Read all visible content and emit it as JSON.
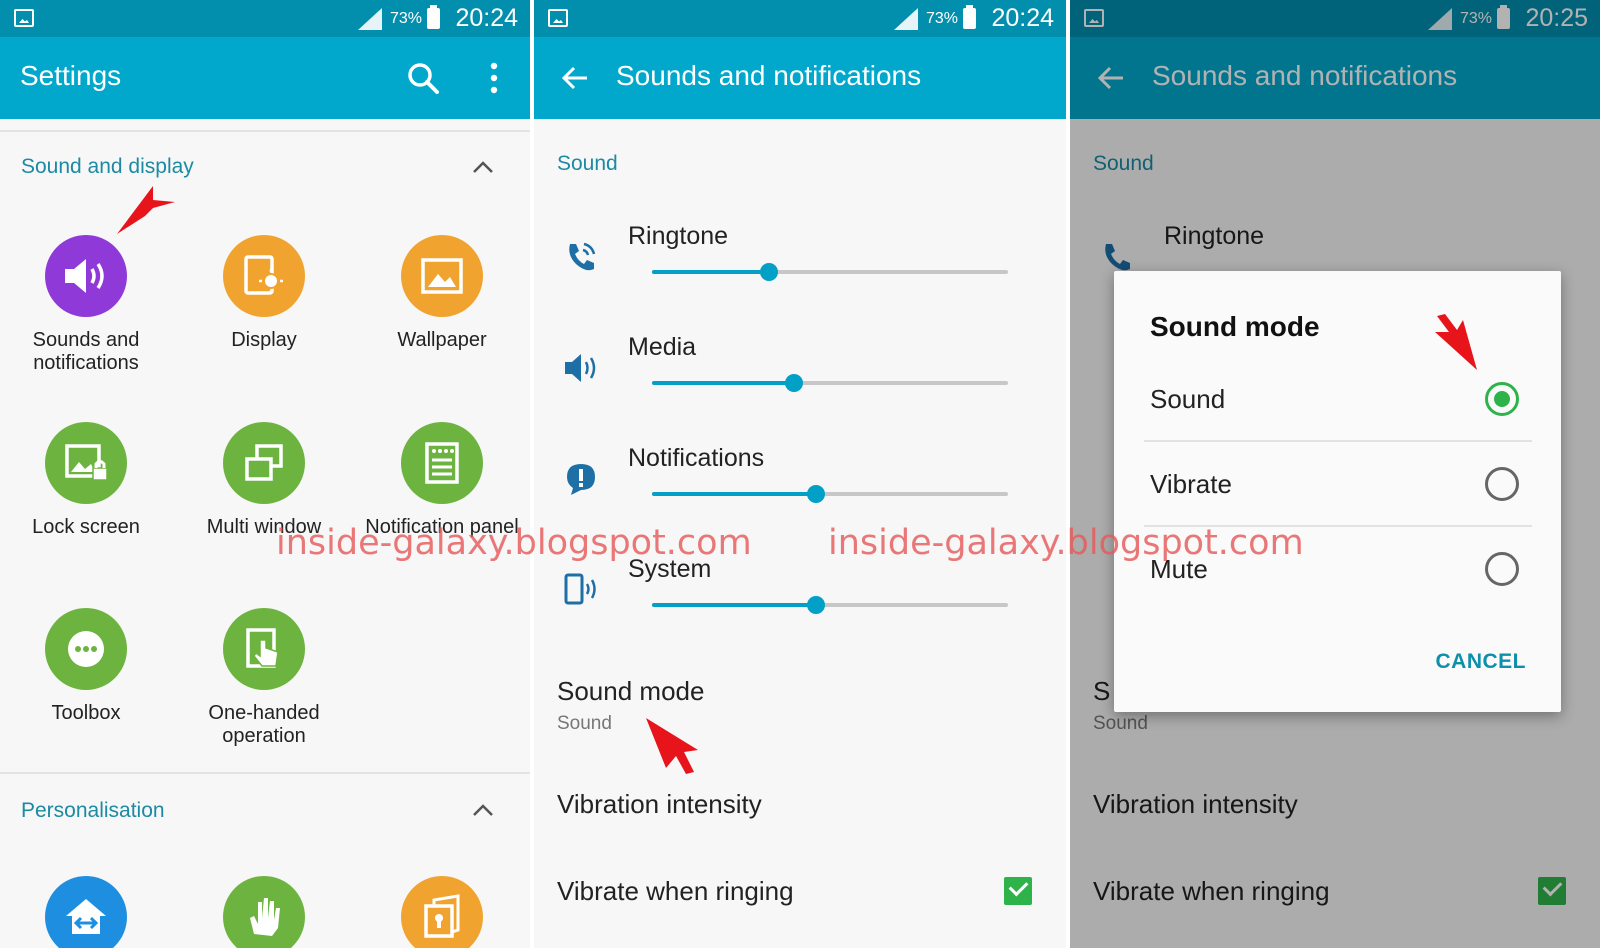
{
  "panel1": {
    "status": {
      "battery": "73%",
      "time": "20:24"
    },
    "appbar": {
      "title": "Settings",
      "search_icon": "search-icon",
      "more_icon": "more-vert-icon"
    },
    "section_sound_display": "Sound and display",
    "tiles": [
      {
        "label": "Sounds and notifications",
        "icon": "volume-icon",
        "color": "#8f3ad8"
      },
      {
        "label": "Display",
        "icon": "display-icon",
        "color": "#f0a42f"
      },
      {
        "label": "Wallpaper",
        "icon": "wallpaper-icon",
        "color": "#f0a42f"
      },
      {
        "label": "Lock screen",
        "icon": "lock-screen-icon",
        "color": "#6db33f"
      },
      {
        "label": "Multi window",
        "icon": "multi-window-icon",
        "color": "#6db33f"
      },
      {
        "label": "Notification panel",
        "icon": "notification-panel-icon",
        "color": "#6db33f"
      },
      {
        "label": "Toolbox",
        "icon": "toolbox-icon",
        "color": "#6db33f"
      },
      {
        "label": "One-handed operation",
        "icon": "one-handed-icon",
        "color": "#6db33f"
      }
    ],
    "section_personalisation": "Personalisation",
    "personal_tiles": [
      {
        "icon": "easy-mode-icon",
        "color": "#1e8fe0"
      },
      {
        "icon": "motions-icon",
        "color": "#6db33f"
      },
      {
        "icon": "private-mode-icon",
        "color": "#f0a42f"
      }
    ]
  },
  "panel2": {
    "status": {
      "battery": "73%",
      "time": "20:24"
    },
    "appbar": {
      "title": "Sounds and notifications"
    },
    "sound_header": "Sound",
    "volumes": [
      {
        "label": "Ringtone",
        "icon": "ringtone-icon",
        "level": 0.33
      },
      {
        "label": "Media",
        "icon": "media-volume-icon",
        "level": 0.4
      },
      {
        "label": "Notifications",
        "icon": "notification-icon",
        "level": 0.46
      },
      {
        "label": "System",
        "icon": "system-icon",
        "level": 0.46
      }
    ],
    "sound_mode": {
      "title": "Sound mode",
      "value": "Sound"
    },
    "vibration_intensity": "Vibration intensity",
    "vibrate_when_ringing": {
      "label": "Vibrate when ringing",
      "checked": true
    }
  },
  "panel3": {
    "status": {
      "battery": "73%",
      "time": "20:25"
    },
    "appbar": {
      "title": "Sounds and notifications"
    },
    "sound_header": "Sound",
    "ringtone_label": "Ringtone",
    "sound_mode_partial": "S",
    "sound_mode_value": "Sound",
    "vibration_intensity": "Vibration intensity",
    "vibrate_when_ringing": "Vibrate when ringing",
    "dialog": {
      "title": "Sound mode",
      "options": [
        {
          "label": "Sound",
          "selected": true
        },
        {
          "label": "Vibrate",
          "selected": false
        },
        {
          "label": "Mute",
          "selected": false
        }
      ],
      "cancel": "CANCEL"
    }
  },
  "watermark": "inside-galaxy.blogspot.com",
  "colors": {
    "statusbar": "#028fae",
    "appbar": "#02a8cc",
    "accent": "#02a0c6",
    "header_text": "#1c8aa3",
    "check": "#2eb34a",
    "annotation_arrow": "#e8141b"
  }
}
